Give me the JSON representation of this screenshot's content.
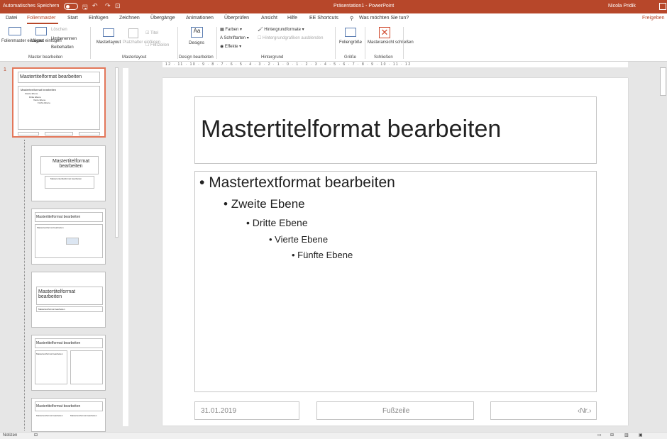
{
  "titlebar": {
    "autosave": "Automatisches Speichern",
    "doc_title": "Präsentation1  -  PowerPoint",
    "user": "Nicola Pridik"
  },
  "menu": {
    "items": [
      "Datei",
      "Folienmaster",
      "Start",
      "Einfügen",
      "Zeichnen",
      "Übergänge",
      "Animationen",
      "Überprüfen",
      "Ansicht",
      "Hilfe",
      "EE Shortcuts"
    ],
    "tell_me": "Was möchten Sie tun?",
    "share": "Freigeben"
  },
  "ribbon": {
    "folienmaster_einfuegen": "Folienmaster einfügen",
    "layout_einfuegen": "Layout einfügen",
    "loeschen": "Löschen",
    "umbenennen": "Umbenennen",
    "beibehalten": "Beibehalten",
    "group_master": "Master bearbeiten",
    "masterlayout": "Masterlayout",
    "platzhalter": "Platzhalter einfügen",
    "titel": "Titel",
    "fusszeilen": "Fußzeilen",
    "group_masterlayout": "Masterlayout",
    "designs": "Designs",
    "group_design": "Design bearbeiten",
    "farben": "Farben",
    "schriftarten": "Schriftarten",
    "effekte": "Effekte",
    "hintergrundformate": "Hintergrundformate",
    "hintergrund_ausblenden": "Hintergrundgrafiken ausblenden",
    "group_hintergrund": "Hintergrund",
    "foliengroesse": "Foliengröße",
    "group_groesse": "Größe",
    "masteransicht": "Masteransicht schließen",
    "group_schliessen": "Schließen"
  },
  "thumbs": {
    "num": "1",
    "t1_title": "Mastertitelformat bearbeiten",
    "t1_l1": "Mastertextformat bearbeiten",
    "t1_l2": "Zweite Ebene",
    "t1_l3": "Dritte Ebene",
    "t1_l4": "Vierte Ebene",
    "t1_l5": "Fünfte Ebene",
    "t2_title": "Mastertitelformat bearbeiten",
    "t2_sub": "Masteruntertitelformat bearbeiten",
    "t3_title": "Mastertitelformat bearbeiten",
    "t3_l1": "Mastertextformat bearbeiten",
    "t4_title": "Mastertitelformat bearbeiten",
    "t4_sub": "Mastertextformat bearbeiten",
    "t5_title": "Mastertitelformat bearbeiten",
    "t5_l1": "Mastertextformat bearbeiten",
    "t6_title": "Mastertitelformat bearbeiten",
    "t6_h1": "Mastertextformat bearbeiten",
    "t6_h2": "Mastertextformat bearbeiten"
  },
  "slide": {
    "title": "Mastertitelformat bearbeiten",
    "level1": "Mastertextformat bearbeiten",
    "level2": "Zweite Ebene",
    "level3": "Dritte Ebene",
    "level4": "Vierte Ebene",
    "level5": "Fünfte Ebene",
    "date": "31.01.2019",
    "footer": "Fußzeile",
    "number": "‹Nr.›"
  },
  "ruler": {
    "ticks": "12 · 11 · 10 · 9 · 8 · 7 · 6 · 5 · 4 · 3 · 2 · 1 · 0 · 1 · 2 · 3 · 4 · 5 · 6 · 7 · 8 · 9 · 10 · 11 · 12"
  },
  "status": {
    "notes": "Notizen"
  },
  "colors": {
    "accent": "#b7472a",
    "selection": "#e3775a"
  }
}
